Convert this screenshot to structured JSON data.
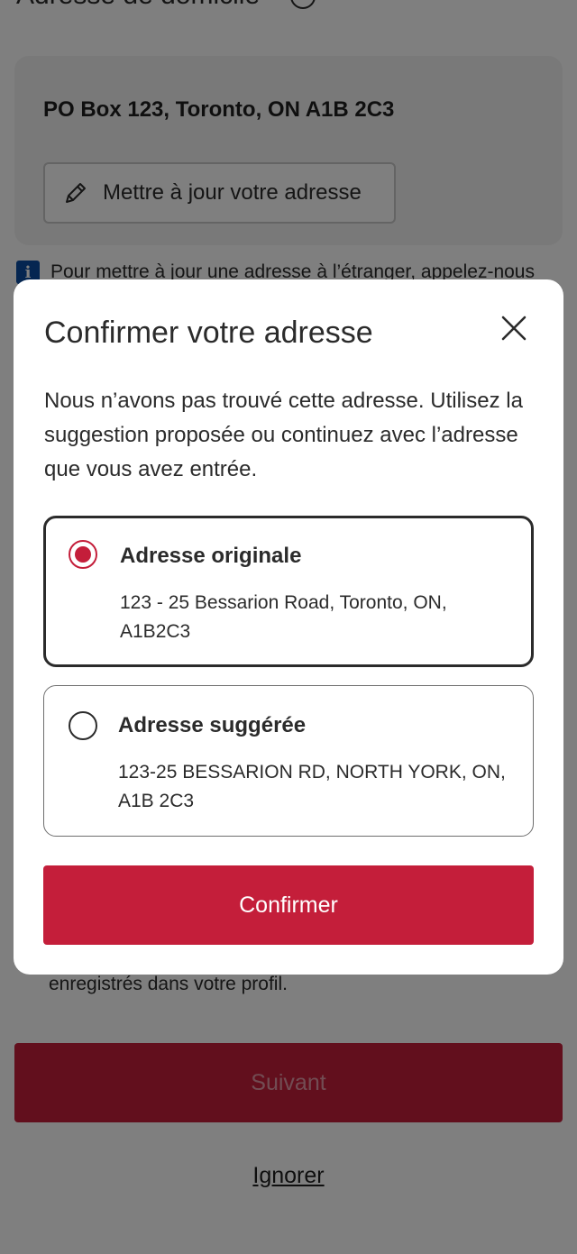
{
  "background": {
    "section_title": "Adresse de domicile",
    "home_address": "PO Box 123, Toronto, ON A1B 2C3",
    "update_button_label": "Mettre à jour votre adresse",
    "info_text": "Pour mettre à jour une adresse à l’étranger, appelez-nous",
    "footnote_text": "enregistrés dans votre profil.",
    "next_button_label": "Suivant",
    "skip_link_label": "Ignorer"
  },
  "modal": {
    "title": "Confirmer votre adresse",
    "description": "Nous n’avons pas trouvé cette adresse. Utilisez la suggestion proposée ou continuez avec l’adresse que vous avez entrée.",
    "options": [
      {
        "title": "Adresse originale",
        "address": "123 - 25 Bessarion Road, Toronto, ON, A1B2C3",
        "selected": true
      },
      {
        "title": "Adresse suggérée",
        "address": "123-25 BESSARION RD, NORTH YORK, ON, A1B 2C3",
        "selected": false
      }
    ],
    "confirm_button_label": "Confirmer"
  },
  "icons": {
    "close": "close-icon",
    "pencil": "pencil-icon",
    "info": "info-icon",
    "help": "help-icon"
  },
  "colors": {
    "brand_red": "#c41e3a",
    "info_blue": "#0a4da2",
    "text": "#2b2b2b"
  }
}
